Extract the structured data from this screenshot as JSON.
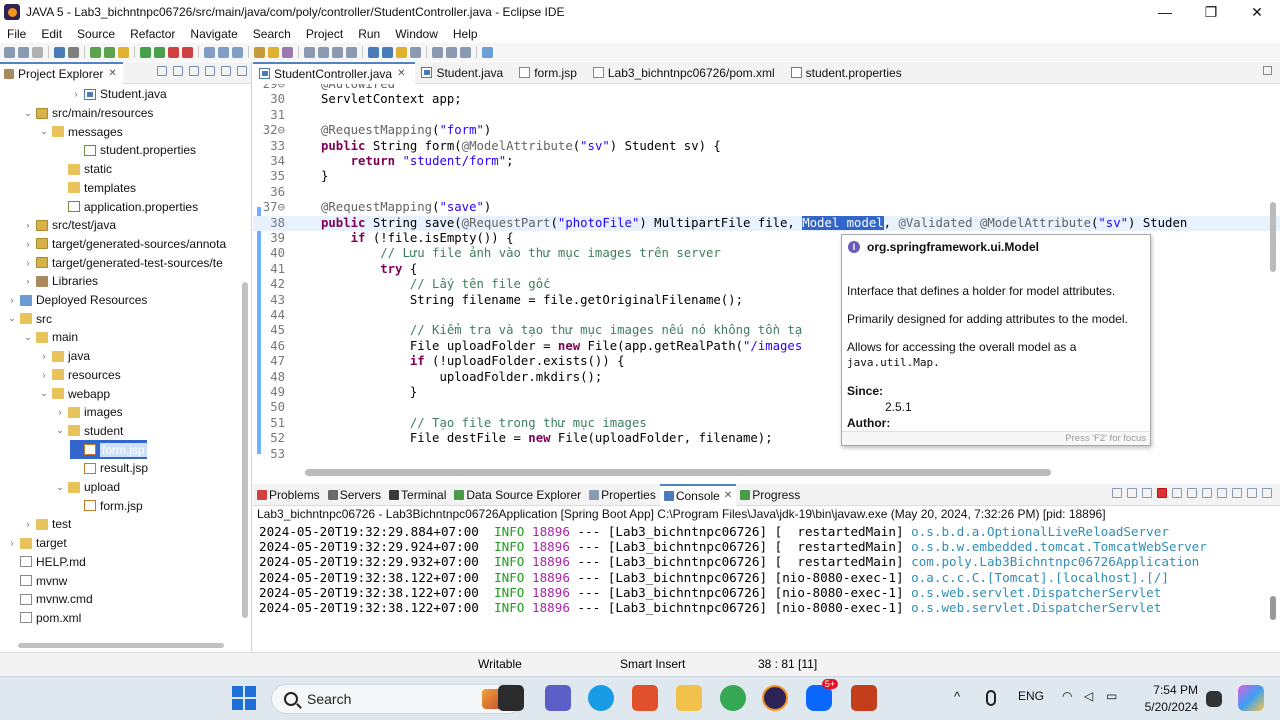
{
  "window": {
    "title": "JAVA 5 - Lab3_bichntnpc06726/src/main/java/com/poly/controller/StudentController.java - Eclipse IDE",
    "controls": {
      "minimize": "—",
      "maximize": "❐",
      "close": "✕"
    }
  },
  "menu": [
    "File",
    "Edit",
    "Source",
    "Refactor",
    "Navigate",
    "Search",
    "Project",
    "Run",
    "Window",
    "Help"
  ],
  "explorer": {
    "tab_label": "Project Explorer",
    "items": [
      {
        "label": "Student.java",
        "icon": "java-file-icon",
        "indent": 5,
        "arrow": "›"
      },
      {
        "label": "src/main/resources",
        "icon": "package-folder-icon",
        "indent": 2,
        "arrow": "⌄"
      },
      {
        "label": "messages",
        "icon": "folder-icon",
        "indent": 3,
        "arrow": "⌄"
      },
      {
        "label": "student.properties",
        "icon": "properties-file-icon",
        "indent": 5,
        "arrow": ""
      },
      {
        "label": "static",
        "icon": "folder-icon",
        "indent": 4,
        "arrow": ""
      },
      {
        "label": "templates",
        "icon": "folder-icon",
        "indent": 4,
        "arrow": ""
      },
      {
        "label": "application.properties",
        "icon": "properties-file-icon",
        "indent": 4,
        "arrow": ""
      },
      {
        "label": "src/test/java",
        "icon": "package-folder-icon",
        "indent": 2,
        "arrow": "›"
      },
      {
        "label": "target/generated-sources/annota",
        "icon": "package-folder-icon",
        "indent": 2,
        "arrow": "›"
      },
      {
        "label": "target/generated-test-sources/te",
        "icon": "package-folder-icon",
        "indent": 2,
        "arrow": "›"
      },
      {
        "label": "Libraries",
        "icon": "library-icon",
        "indent": 2,
        "arrow": "›"
      },
      {
        "label": "Deployed Resources",
        "icon": "deployed-resources-icon",
        "indent": 1,
        "arrow": "›"
      },
      {
        "label": "src",
        "icon": "folder-icon",
        "indent": 1,
        "arrow": "⌄"
      },
      {
        "label": "main",
        "icon": "folder-icon",
        "indent": 2,
        "arrow": "⌄"
      },
      {
        "label": "java",
        "icon": "folder-icon",
        "indent": 3,
        "arrow": "›"
      },
      {
        "label": "resources",
        "icon": "folder-icon",
        "indent": 3,
        "arrow": "›"
      },
      {
        "label": "webapp",
        "icon": "folder-icon",
        "indent": 3,
        "arrow": "⌄"
      },
      {
        "label": "images",
        "icon": "folder-icon",
        "indent": 4,
        "arrow": "›"
      },
      {
        "label": "student",
        "icon": "folder-icon",
        "indent": 4,
        "arrow": "⌄"
      },
      {
        "label": "form.jsp",
        "icon": "jsp-file-icon",
        "indent": 5,
        "arrow": "",
        "selected": true
      },
      {
        "label": "result.jsp",
        "icon": "jsp-file-icon",
        "indent": 5,
        "arrow": ""
      },
      {
        "label": "upload",
        "icon": "folder-icon",
        "indent": 4,
        "arrow": "⌄"
      },
      {
        "label": "form.jsp",
        "icon": "jsp-file-icon",
        "indent": 5,
        "arrow": ""
      },
      {
        "label": "test",
        "icon": "folder-icon",
        "indent": 2,
        "arrow": "›"
      },
      {
        "label": "target",
        "icon": "folder-icon",
        "indent": 1,
        "arrow": "›"
      },
      {
        "label": "HELP.md",
        "icon": "text-file-icon",
        "indent": 1,
        "arrow": ""
      },
      {
        "label": "mvnw",
        "icon": "text-file-icon",
        "indent": 1,
        "arrow": ""
      },
      {
        "label": "mvnw.cmd",
        "icon": "text-file-icon",
        "indent": 1,
        "arrow": ""
      },
      {
        "label": "pom.xml",
        "icon": "xml-file-icon",
        "indent": 1,
        "arrow": ""
      }
    ]
  },
  "editor": {
    "tabs": [
      {
        "label": "StudentController.java",
        "active": true,
        "closable": true
      },
      {
        "label": "Student.java",
        "active": false,
        "closable": false
      },
      {
        "label": "form.jsp",
        "active": false,
        "closable": false
      },
      {
        "label": "Lab3_bichntnpc06726/pom.xml",
        "active": false,
        "closable": false
      },
      {
        "label": "student.properties",
        "active": false,
        "closable": false
      }
    ],
    "lines": [
      {
        "n": "29⊖",
        "tokens": [
          {
            "t": "@Autowired",
            "c": "ann"
          }
        ]
      },
      {
        "n": "30",
        "tokens": [
          {
            "t": "ServletContext app;",
            "c": ""
          }
        ]
      },
      {
        "n": "31",
        "tokens": []
      },
      {
        "n": "32⊖",
        "tokens": [
          {
            "t": "@RequestMapping",
            "c": "ann"
          },
          {
            "t": "(",
            "c": ""
          },
          {
            "t": "\"form\"",
            "c": "str"
          },
          {
            "t": ")",
            "c": ""
          }
        ]
      },
      {
        "n": "33",
        "tokens": [
          {
            "t": "public",
            "c": "kw"
          },
          {
            "t": " String form(",
            "c": ""
          },
          {
            "t": "@ModelAttribute",
            "c": "ann"
          },
          {
            "t": "(",
            "c": ""
          },
          {
            "t": "\"sv\"",
            "c": "str"
          },
          {
            "t": ") Student sv) {",
            "c": ""
          }
        ]
      },
      {
        "n": "34",
        "tokens": [
          {
            "t": "    ",
            "c": ""
          },
          {
            "t": "return",
            "c": "kw"
          },
          {
            "t": " ",
            "c": ""
          },
          {
            "t": "\"student/form\"",
            "c": "str"
          },
          {
            "t": ";",
            "c": ""
          }
        ]
      },
      {
        "n": "35",
        "tokens": [
          {
            "t": "}",
            "c": ""
          }
        ]
      },
      {
        "n": "36",
        "tokens": []
      },
      {
        "n": "37⊖",
        "tokens": [
          {
            "t": "@RequestMapping",
            "c": "ann"
          },
          {
            "t": "(",
            "c": ""
          },
          {
            "t": "\"save\"",
            "c": "str"
          },
          {
            "t": ")",
            "c": ""
          }
        ]
      },
      {
        "n": "38",
        "cur": true,
        "tokens": [
          {
            "t": "public",
            "c": "kw"
          },
          {
            "t": " String save(",
            "c": ""
          },
          {
            "t": "@RequestPart",
            "c": "ann"
          },
          {
            "t": "(",
            "c": ""
          },
          {
            "t": "\"photoFile\"",
            "c": "str"
          },
          {
            "t": ") MultipartFile file, ",
            "c": ""
          },
          {
            "t": "Model model",
            "c": "sel"
          },
          {
            "t": ", ",
            "c": ""
          },
          {
            "t": "@Validated",
            "c": "ann"
          },
          {
            "t": " ",
            "c": ""
          },
          {
            "t": "@ModelAttribute",
            "c": "ann"
          },
          {
            "t": "(",
            "c": ""
          },
          {
            "t": "\"sv\"",
            "c": "str"
          },
          {
            "t": ") Studen",
            "c": ""
          }
        ]
      },
      {
        "n": "39",
        "tokens": [
          {
            "t": "    ",
            "c": ""
          },
          {
            "t": "if",
            "c": "kw"
          },
          {
            "t": " (!file.isEmpty()) {",
            "c": ""
          }
        ]
      },
      {
        "n": "40",
        "tokens": [
          {
            "t": "        ",
            "c": ""
          },
          {
            "t": "// Lưu file ảnh vào thư mục images trên server",
            "c": "cmt"
          }
        ]
      },
      {
        "n": "41",
        "tokens": [
          {
            "t": "        ",
            "c": ""
          },
          {
            "t": "try",
            "c": "kw"
          },
          {
            "t": " {",
            "c": ""
          }
        ]
      },
      {
        "n": "42",
        "tokens": [
          {
            "t": "            ",
            "c": ""
          },
          {
            "t": "// Lấy tên file gốc",
            "c": "cmt"
          }
        ]
      },
      {
        "n": "43",
        "tokens": [
          {
            "t": "            String filename = file.getOriginalFilename();",
            "c": ""
          }
        ]
      },
      {
        "n": "44",
        "tokens": []
      },
      {
        "n": "45",
        "tokens": [
          {
            "t": "            ",
            "c": ""
          },
          {
            "t": "// Kiểm tra và tạo thư mục images nếu nó không tồn tạ",
            "c": "cmt"
          }
        ]
      },
      {
        "n": "46",
        "tokens": [
          {
            "t": "            File uploadFolder = ",
            "c": ""
          },
          {
            "t": "new",
            "c": "kw"
          },
          {
            "t": " File(app.getRealPath(",
            "c": ""
          },
          {
            "t": "\"/images",
            "c": "str"
          }
        ]
      },
      {
        "n": "47",
        "tokens": [
          {
            "t": "            ",
            "c": ""
          },
          {
            "t": "if",
            "c": "kw"
          },
          {
            "t": " (!uploadFolder.exists()) {",
            "c": ""
          }
        ]
      },
      {
        "n": "48",
        "tokens": [
          {
            "t": "                uploadFolder.mkdirs();",
            "c": ""
          }
        ]
      },
      {
        "n": "49",
        "tokens": [
          {
            "t": "            }",
            "c": ""
          }
        ]
      },
      {
        "n": "50",
        "tokens": []
      },
      {
        "n": "51",
        "tokens": [
          {
            "t": "            ",
            "c": ""
          },
          {
            "t": "// Tạo file trong thư mục images",
            "c": "cmt"
          }
        ]
      },
      {
        "n": "52",
        "tokens": [
          {
            "t": "            File destFile = ",
            "c": ""
          },
          {
            "t": "new",
            "c": "kw"
          },
          {
            "t": " File(uploadFolder, filename);",
            "c": ""
          }
        ]
      },
      {
        "n": "53",
        "tokens": []
      }
    ]
  },
  "hover": {
    "title": "org.springframework.ui.Model",
    "desc1": "Interface that defines a holder for model attributes.",
    "desc2": "Primarily designed for adding attributes to the model.",
    "desc3": "Allows for accessing the overall model as a",
    "desc3_code": "java.util.Map.",
    "since_label": "Since:",
    "since_value": "2.5.1",
    "author_label": "Author:",
    "footer": "Press 'F2' for focus"
  },
  "console": {
    "tabs": [
      {
        "label": "Problems",
        "active": false
      },
      {
        "label": "Servers",
        "active": false
      },
      {
        "label": "Terminal",
        "active": false
      },
      {
        "label": "Data Source Explorer",
        "active": false
      },
      {
        "label": "Properties",
        "active": false
      },
      {
        "label": "Console",
        "active": true
      },
      {
        "label": "Progress",
        "active": false
      }
    ],
    "header": "Lab3_bichntnpc06726 - Lab3Bichntnpc06726Application [Spring Boot App] C:\\Program Files\\Java\\jdk-19\\bin\\javaw.exe  (May 20, 2024, 7:32:26 PM) [pid: 18896]",
    "lines": [
      {
        "ts": "2024-05-20T19:32:29.884+07:00",
        "lvl": "INFO",
        "pid": "18896",
        "mid": " --- [Lab3_bichntnpc06726] [  restartedMain] ",
        "logger": "o.s.b.d.a.OptionalLiveReloadServer"
      },
      {
        "ts": "2024-05-20T19:32:29.924+07:00",
        "lvl": "INFO",
        "pid": "18896",
        "mid": " --- [Lab3_bichntnpc06726] [  restartedMain] ",
        "logger": "o.s.b.w.embedded.tomcat.TomcatWebServer"
      },
      {
        "ts": "2024-05-20T19:32:29.932+07:00",
        "lvl": "INFO",
        "pid": "18896",
        "mid": " --- [Lab3_bichntnpc06726] [  restartedMain] ",
        "logger": "com.poly.Lab3Bichntnpc06726Application"
      },
      {
        "ts": "2024-05-20T19:32:38.122+07:00",
        "lvl": "INFO",
        "pid": "18896",
        "mid": " --- [Lab3_bichntnpc06726] [nio-8080-exec-1] ",
        "logger": "o.a.c.c.C.[Tomcat].[localhost].[/]"
      },
      {
        "ts": "2024-05-20T19:32:38.122+07:00",
        "lvl": "INFO",
        "pid": "18896",
        "mid": " --- [Lab3_bichntnpc06726] [nio-8080-exec-1] ",
        "logger": "o.s.web.servlet.DispatcherServlet"
      },
      {
        "ts": "2024-05-20T19:32:38.122+07:00",
        "lvl": "INFO",
        "pid": "18896",
        "mid": " --- [Lab3_bichntnpc06726] [nio-8080-exec-1] ",
        "logger": "o.s.web.servlet.DispatcherServlet"
      }
    ]
  },
  "status": {
    "mode": "Writable",
    "insert": "Smart Insert",
    "position": "38 : 81 [11]"
  },
  "taskbar": {
    "search_placeholder": "Search",
    "teams_badge": "5+",
    "language": "ENG",
    "time": "7:54 PM",
    "date": "5/20/2024"
  },
  "colors": {
    "accent": "#4f83c3",
    "selection": "#3366cc",
    "keyword": "#7f0055",
    "string": "#2a00ff",
    "comment": "#3f7f5f"
  }
}
